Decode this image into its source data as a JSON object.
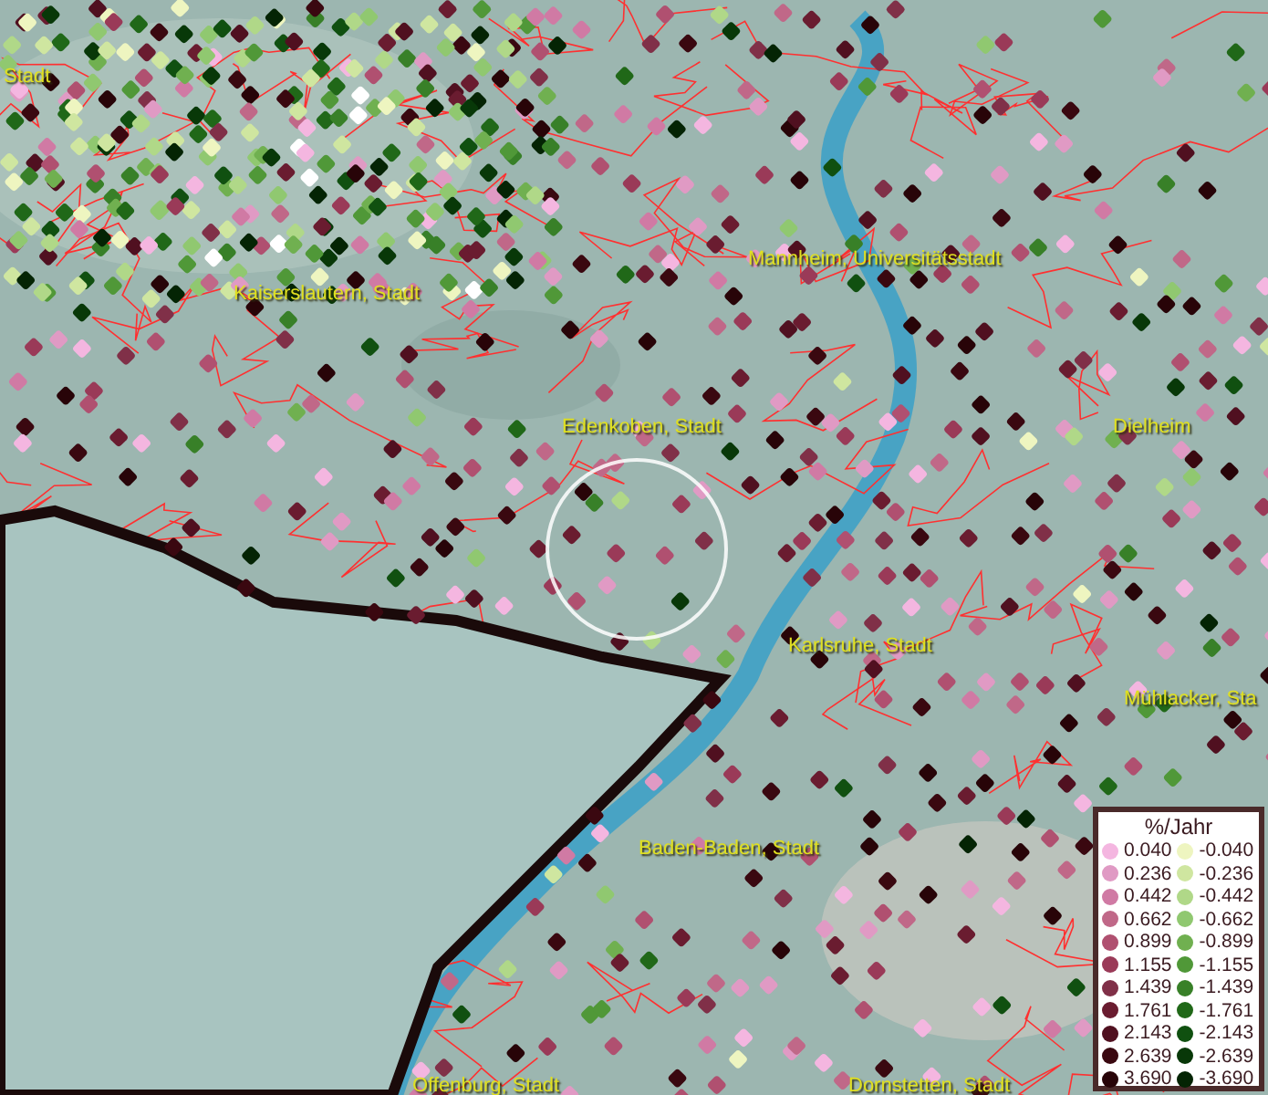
{
  "map": {
    "place_labels": [
      {
        "text": "Stadt"
      },
      {
        "text": "Kaiserslautern, Stadt"
      },
      {
        "text": "Mannheim, Universitätsstadt"
      },
      {
        "text": "Edenkoben, Stadt"
      },
      {
        "text": "Dielheim"
      },
      {
        "text": "Karlsruhe, Stadt"
      },
      {
        "text": "Mühlacker, Sta"
      },
      {
        "text": "Baden-Baden, Stadt"
      },
      {
        "text": "Offenburg, Stadt"
      },
      {
        "text": "Dornstetten, Stadt"
      }
    ]
  },
  "legend": {
    "title": "%/Jahr",
    "positive": [
      {
        "value": "0.040",
        "color": "#f4b6e0"
      },
      {
        "value": "0.236",
        "color": "#e09ac4"
      },
      {
        "value": "0.442",
        "color": "#d07aa4"
      },
      {
        "value": "0.662",
        "color": "#c06888"
      },
      {
        "value": "0.899",
        "color": "#b05070"
      },
      {
        "value": "1.155",
        "color": "#9a3a58"
      },
      {
        "value": "1.439",
        "color": "#803048"
      },
      {
        "value": "1.761",
        "color": "#6a1c30"
      },
      {
        "value": "2.143",
        "color": "#501020"
      },
      {
        "value": "2.639",
        "color": "#3a0810"
      },
      {
        "value": "3.690",
        "color": "#280408"
      }
    ],
    "negative": [
      {
        "value": "-0.040",
        "color": "#eef5c0"
      },
      {
        "value": "-0.236",
        "color": "#cfe6a0"
      },
      {
        "value": "-0.442",
        "color": "#b0d888"
      },
      {
        "value": "-0.662",
        "color": "#90c870"
      },
      {
        "value": "-0.899",
        "color": "#70b050"
      },
      {
        "value": "-1.155",
        "color": "#509838"
      },
      {
        "value": "-1.439",
        "color": "#388028"
      },
      {
        "value": "-1.761",
        "color": "#206818"
      },
      {
        "value": "-2.143",
        "color": "#105010"
      },
      {
        "value": "-2.639",
        "color": "#083808"
      },
      {
        "value": "-3.690",
        "color": "#042404"
      }
    ]
  }
}
